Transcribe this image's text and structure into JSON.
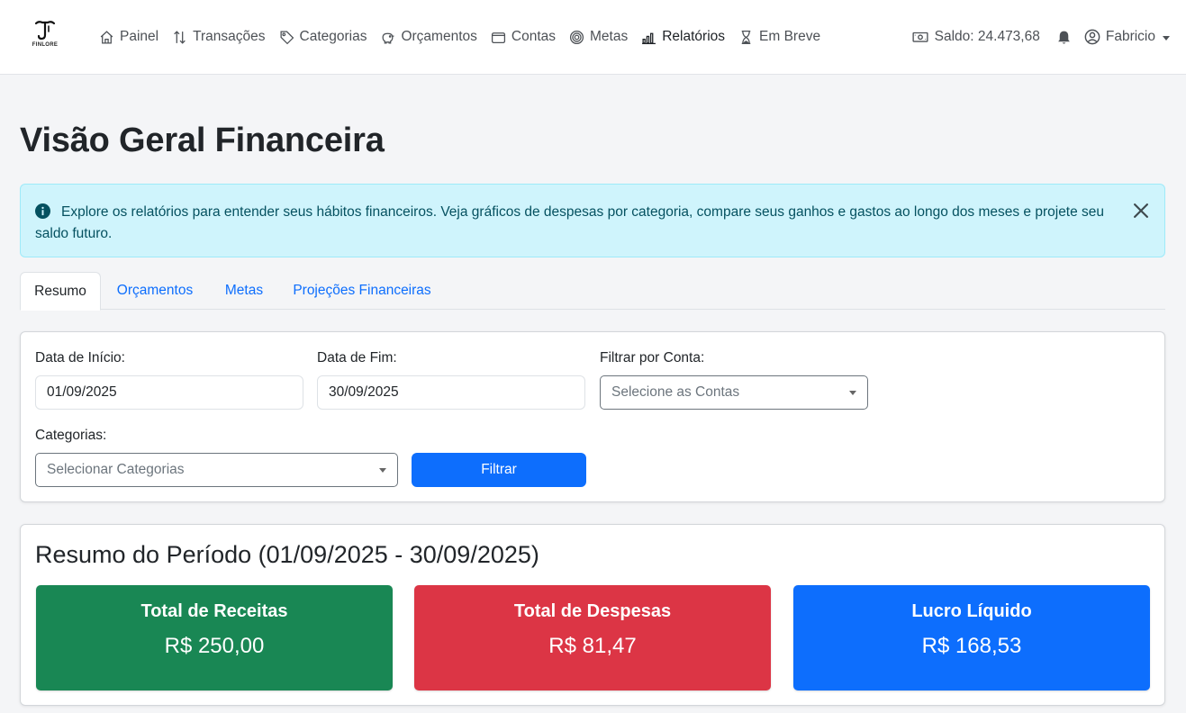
{
  "brand": {
    "name": "FINLORE"
  },
  "nav": {
    "items": [
      {
        "label": "Painel",
        "icon": "house-icon"
      },
      {
        "label": "Transações",
        "icon": "arrows-up-down-icon"
      },
      {
        "label": "Categorias",
        "icon": "tag-icon"
      },
      {
        "label": "Orçamentos",
        "icon": "piggy-bank-icon"
      },
      {
        "label": "Contas",
        "icon": "wallet-icon"
      },
      {
        "label": "Metas",
        "icon": "target-icon"
      },
      {
        "label": "Relatórios",
        "icon": "bar-chart-icon",
        "active": true
      },
      {
        "label": "Em Breve",
        "icon": "hourglass-icon"
      }
    ],
    "saldo": "Saldo: 24.473,68",
    "user": "Fabricio"
  },
  "page": {
    "title": "Visão Geral Financeira"
  },
  "alert": {
    "text": "Explore os relatórios para entender seus hábitos financeiros. Veja gráficos de despesas por categoria, compare seus ganhos e gastos ao longo dos meses e projete seu saldo futuro."
  },
  "tabs": [
    {
      "label": "Resumo",
      "active": true
    },
    {
      "label": "Orçamentos"
    },
    {
      "label": "Metas"
    },
    {
      "label": "Projeções Financeiras"
    }
  ],
  "filters": {
    "start_label": "Data de Início:",
    "start_value": "01/09/2025",
    "end_label": "Data de Fim:",
    "end_value": "30/09/2025",
    "account_label": "Filtrar por Conta:",
    "account_placeholder": "Selecione as Contas",
    "categories_label": "Categorias:",
    "categories_placeholder": "Selecionar Categorias",
    "submit_label": "Filtrar"
  },
  "summary": {
    "title": "Resumo do Período (01/09/2025 - 30/09/2025)",
    "income_label": "Total de Receitas",
    "income_value": "R$ 250,00",
    "expense_label": "Total de Despesas",
    "expense_value": "R$ 81,47",
    "profit_label": "Lucro Líquido",
    "profit_value": "R$ 168,53"
  },
  "colors": {
    "primary": "#0d6efd",
    "success": "#198754",
    "danger": "#dc3545",
    "info_bg": "#cff4fc",
    "info_text": "#055160"
  }
}
